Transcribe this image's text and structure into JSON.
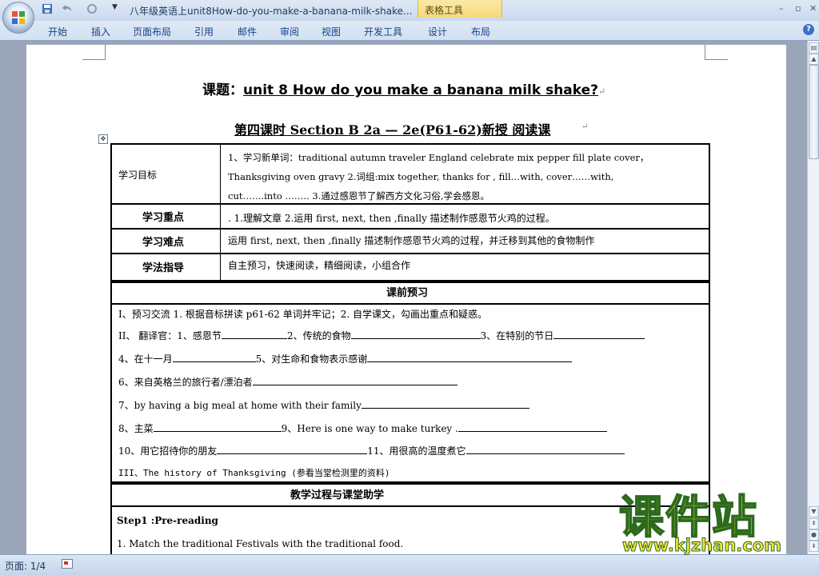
{
  "window": {
    "doc_title": "八年级英语上unit8How-do-you-make-a-banana-milk-shake...",
    "context_tab": "表格工具",
    "tabs": [
      "开始",
      "插入",
      "页面布局",
      "引用",
      "邮件",
      "审阅",
      "视图",
      "开发工具",
      "设计",
      "布局"
    ],
    "help_label": "?"
  },
  "document": {
    "title_prefix": "课题：",
    "title_topic": "unit 8 How do you make a banana milk shake?",
    "subtitle": "第四课时 Section B 2a — 2e(P61-62)新授 阅读课",
    "rows": {
      "goals_label": "学习目标",
      "goals_line1": "1、学习新单词：traditional autumn traveler England celebrate mix pepper fill plate cover，",
      "goals_line2": "Thanksgiving oven gravy 2.词组:mix together, thanks for , fill…with, cover……with,",
      "goals_line3": "cut…….into ……..          3.通过感恩节了解西方文化习俗,学会感恩。",
      "key_label": "学习重点",
      "key_text": ". 1.理解文章 2.运用 first, next, then ,finally 描述制作感恩节火鸡的过程。",
      "difficult_label": "学习难点",
      "difficult_text": "运用 first, next, then ,finally 描述制作感恩节火鸡的过程，并迁移到其他的食物制作",
      "method_label": "学法指导",
      "method_text": "自主预习，快速阅读，精细阅读，小组合作",
      "preview_header": "课前预习",
      "p1": "I、预习交流 1. 根据音标拼读 p61-62 单词并牢记；2. 自学课文，勾画出重点和疑惑。",
      "p2a": "II、  翻译官：1、感恩节",
      "p2b": "2、传统的食物",
      "p2c": "3、在特别的节日",
      "p3a": "4、在十一月",
      "p3b": "5、对生命和食物表示感谢",
      "p4": "6、来自英格兰的旅行者/漂泊者",
      "p5": "7、by having a big meal at home with their family",
      "p6a": "8、主菜",
      "p6b": "9、Here is one way to make turkey .",
      "p7a": "10、用它招待你的朋友",
      "p7b": "11、用很高的温度煮它",
      "p8": "III、The history of Thanksgiving (参看当堂检测里的资料)",
      "process_header": "教学过程与课堂助学",
      "step1": "Step1 :Pre-reading",
      "match": "1. Match the traditional Festivals with the traditional food."
    }
  },
  "status": {
    "page": "页面: 1/4"
  },
  "watermark": {
    "big": "课件站",
    "url": "www.kjzhan.com"
  },
  "colors": {
    "ribbon": "#dfe9f5",
    "tab_text": "#15428b",
    "context_tab": "#f5d879",
    "watermark_fill": "#f6e43a",
    "watermark_stroke": "#2c6a1e"
  }
}
